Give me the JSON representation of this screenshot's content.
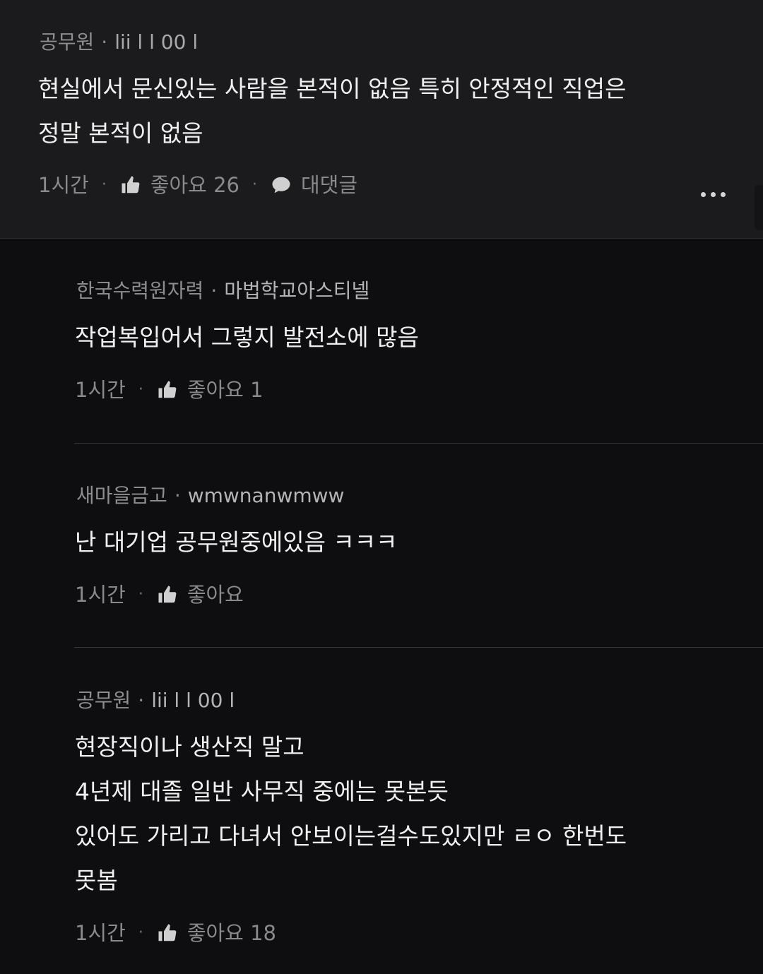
{
  "parent_comment": {
    "group": "공무원",
    "separator": "·",
    "username": "lii l  l 00 l",
    "lines": [
      "현실에서 문신있는 사람을 본적이 없음 특히 안정적인 직업은",
      "정말 본적이 없음"
    ],
    "time": "1시간",
    "like_label": "좋아요 26",
    "reply_label": "대댓글"
  },
  "replies": [
    {
      "group": "한국수력원자력",
      "separator": "·",
      "username": "마법학교아스티넬",
      "lines": [
        "작업복입어서 그렇지 발전소에 많음"
      ],
      "time": "1시간",
      "like_label": "좋아요 1"
    },
    {
      "group": "새마을금고",
      "separator": "·",
      "username": "wmwnanwmww",
      "lines": [
        "난 대기업 공무원중에있음 ㅋㅋㅋ"
      ],
      "time": "1시간",
      "like_label": "좋아요"
    },
    {
      "group": "공무원",
      "separator": "·",
      "username": "lii l  l 00 l",
      "lines": [
        "현장직이나 생산직 말고",
        "4년제 대졸 일반 사무직 중에는 못본듯",
        "있어도 가리고 다녀서 안보이는걸수도있지만 ㄹㅇ 한번도",
        "못봄"
      ],
      "time": "1시간",
      "like_label": "좋아요 18"
    }
  ],
  "action_dot": "·",
  "icons": {
    "like": "thumbs-up-icon",
    "reply": "speech-bubble-icon",
    "more": "more-dots-icon"
  },
  "colors": {
    "background": "#0e0e10",
    "parent_background": "#1b1b1d",
    "text": "#f0f0f0",
    "muted": "#8a8a8e"
  }
}
